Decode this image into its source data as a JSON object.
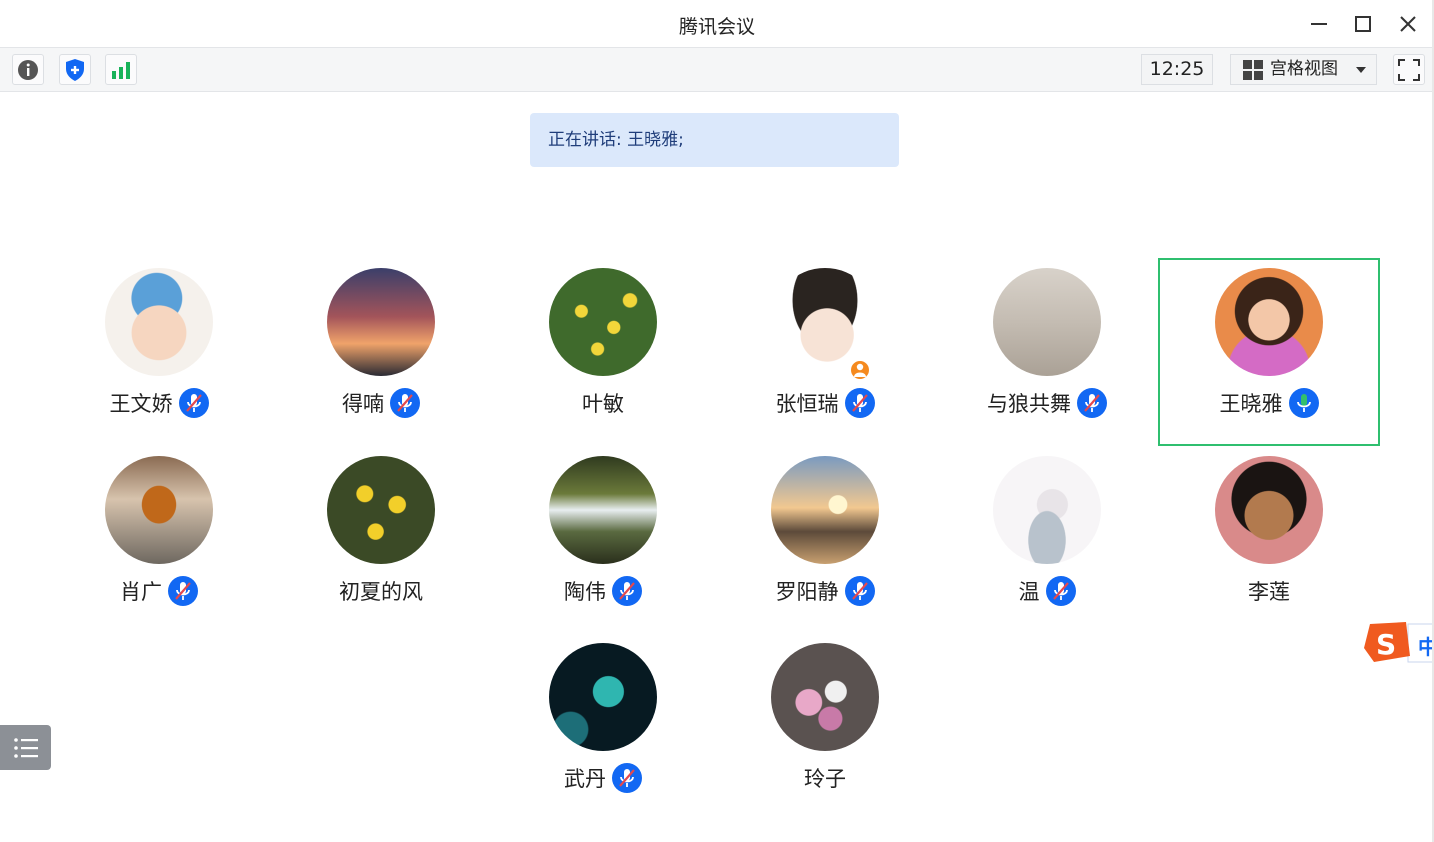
{
  "window": {
    "title": "腾讯会议"
  },
  "toolbar": {
    "clock": "12:25",
    "view_label": "宫格视图"
  },
  "banner": {
    "speaking": "正在讲话: 王晓雅;"
  },
  "participants": [
    {
      "name": "王文娇",
      "mic": "muted"
    },
    {
      "name": "得喃",
      "mic": "muted"
    },
    {
      "name": "叶敏",
      "mic": "none"
    },
    {
      "name": "张恒瑞",
      "mic": "muted",
      "host": true
    },
    {
      "name": "与狼共舞",
      "mic": "muted"
    },
    {
      "name": "王晓雅",
      "mic": "speaking",
      "active": true
    },
    {
      "name": "肖广",
      "mic": "muted"
    },
    {
      "name": "初夏的风",
      "mic": "none"
    },
    {
      "name": "陶伟",
      "mic": "muted"
    },
    {
      "name": "罗阳静",
      "mic": "muted"
    },
    {
      "name": "温",
      "mic": "muted"
    },
    {
      "name": "李莲",
      "mic": "none"
    },
    {
      "name": "武丹",
      "mic": "muted"
    },
    {
      "name": "玲子",
      "mic": "none"
    }
  ],
  "ime": {
    "label": "中"
  },
  "colors": {
    "accent": "#1268f3",
    "active_border": "#2fbf6f",
    "banner_bg": "#dbe8fb",
    "speaking_mic": "#33c06a"
  }
}
